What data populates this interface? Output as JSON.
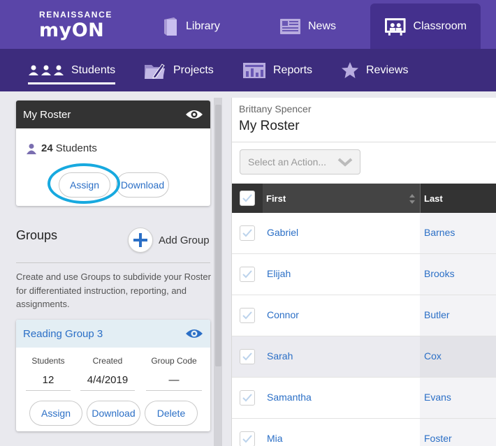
{
  "brand": {
    "top": "RENAISSANCE",
    "name": "myON"
  },
  "nav": {
    "library": "Library",
    "news": "News",
    "classroom": "Classroom"
  },
  "subnav": {
    "students": "Students",
    "projects": "Projects",
    "reports": "Reports",
    "reviews": "Reviews"
  },
  "roster_card": {
    "title": "My Roster",
    "count": "24",
    "count_label": "Students",
    "assign": "Assign",
    "download": "Download"
  },
  "groups": {
    "title": "Groups",
    "add": "Add Group",
    "description": "Create and use Groups to subdivide your Roster for differentiated instruction, reporting, and assignments."
  },
  "group_card": {
    "name": "Reading Group 3",
    "students_label": "Students",
    "created_label": "Created",
    "code_label": "Group Code",
    "students": "12",
    "created": "4/4/2019",
    "code": "—",
    "assign": "Assign",
    "download": "Download",
    "delete": "Delete"
  },
  "main": {
    "teacher": "Brittany Spencer",
    "title": "My Roster",
    "action_placeholder": "Select an Action...",
    "col_first": "First",
    "col_last": "Last",
    "rows": [
      {
        "first": "Gabriel",
        "last": "Barnes"
      },
      {
        "first": "Elijah",
        "last": "Brooks"
      },
      {
        "first": "Connor",
        "last": "Butler"
      },
      {
        "first": "Sarah",
        "last": "Cox"
      },
      {
        "first": "Samantha",
        "last": "Evans"
      },
      {
        "first": "Mia",
        "last": "Foster"
      }
    ]
  },
  "colors": {
    "topbar": "#5a45a8",
    "subbar": "#3d2c7d",
    "link": "#2b6fc6",
    "highlight_ring": "#17a9df"
  }
}
